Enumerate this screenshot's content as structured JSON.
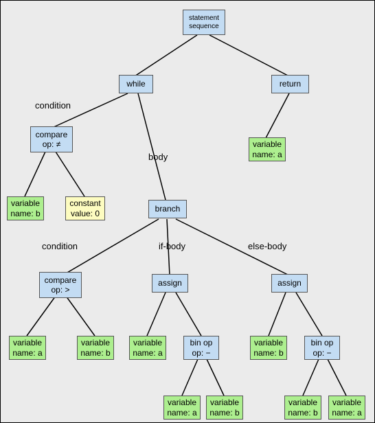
{
  "nodes": {
    "root": {
      "text": "statement\nsequence"
    },
    "while": {
      "text": "while"
    },
    "return": {
      "text": "return"
    },
    "cmp1": {
      "text": "compare\nop: ≠"
    },
    "var_b1": {
      "text": "variable\nname: b"
    },
    "const0": {
      "text": "constant\nvalue: 0"
    },
    "branch": {
      "text": "branch"
    },
    "var_a_ret": {
      "text": "variable\nname: a"
    },
    "cmp2": {
      "text": "compare\nop: >"
    },
    "var_a2": {
      "text": "variable\nname: a"
    },
    "var_b2": {
      "text": "variable\nname: b"
    },
    "assign1": {
      "text": "assign"
    },
    "assign2": {
      "text": "assign"
    },
    "var_a3": {
      "text": "variable\nname: a"
    },
    "binop1": {
      "text": "bin op\nop: −"
    },
    "var_b3": {
      "text": "variable\nname: b"
    },
    "binop2": {
      "text": "bin op\nop: −"
    },
    "var_a4": {
      "text": "variable\nname: a"
    },
    "var_b4": {
      "text": "variable\nname: b"
    },
    "var_b5": {
      "text": "variable\nname: b"
    },
    "var_a5": {
      "text": "variable\nname: a"
    }
  },
  "edge_labels": {
    "cond1": "condition",
    "body": "body",
    "cond2": "condition",
    "ifb": "if-body",
    "elseb": "else-body"
  }
}
